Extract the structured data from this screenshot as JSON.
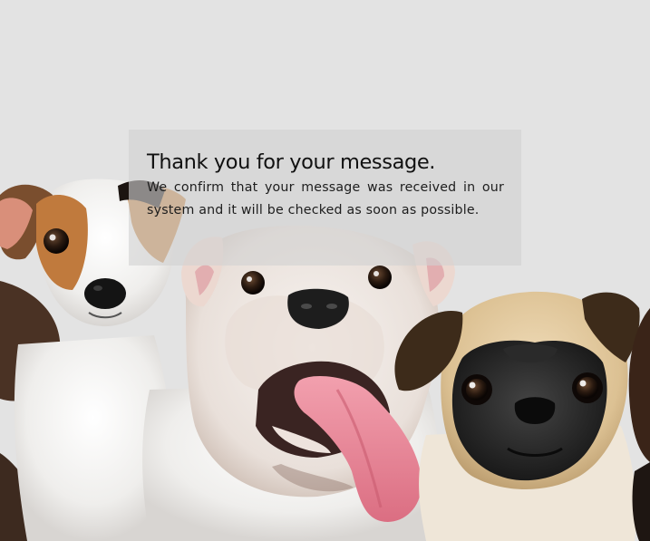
{
  "confirmation": {
    "title": "Thank you for your message.",
    "body": "We confirm that your message was received in our system and it will be checked as soon as possible."
  },
  "colors": {
    "background": "#e3e3e3",
    "card_overlay": "#d2d2d2",
    "title_text": "#111111",
    "body_text": "#1d1d1d"
  },
  "illustration": {
    "icon": "dogs-photo"
  }
}
